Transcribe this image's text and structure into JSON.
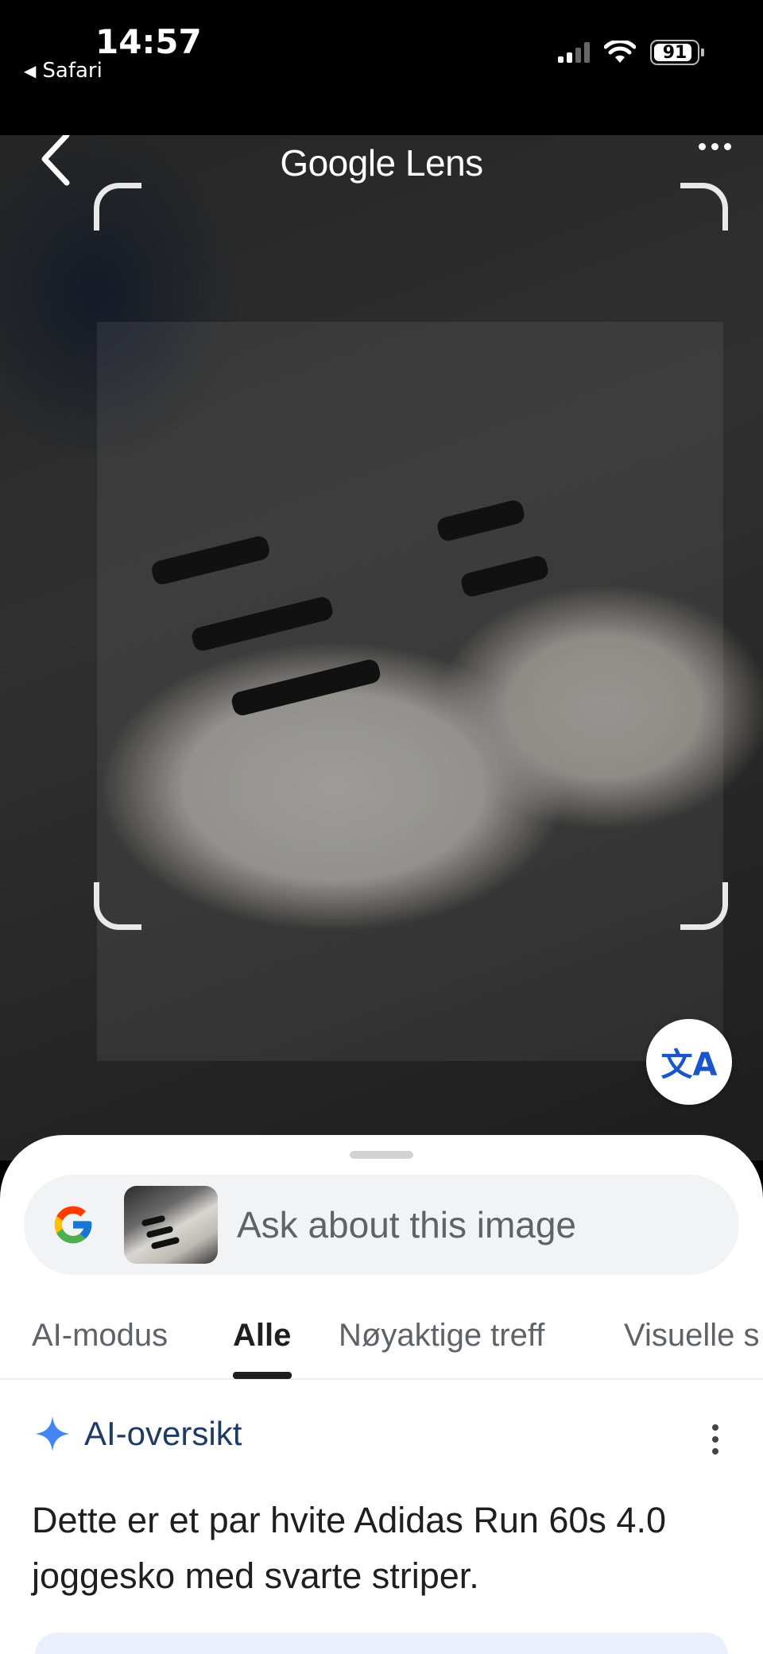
{
  "status_bar": {
    "time": "14:57",
    "back_app": "Safari",
    "battery": "91",
    "battery_level": 0.91
  },
  "header": {
    "title": "Google Lens",
    "back_icon": "chevron-left-icon",
    "more_icon": "more-horizontal-icon"
  },
  "translate_button": {
    "icon": "translate-icon",
    "glyph": "文A"
  },
  "search": {
    "placeholder": "Ask about this image"
  },
  "tabs": [
    {
      "label": "AI-modus"
    },
    {
      "label": "Alle",
      "active": true
    },
    {
      "label": "Nøyaktige treff"
    },
    {
      "label": "Visuelle s"
    }
  ],
  "ai_overview": {
    "heading": "AI-oversikt",
    "answer": "Dette er et par hvite Adidas Run 60s 4.0 joggesko med svarte striper."
  },
  "colors": {
    "accent_blue": "#1a56c8",
    "heading_navy": "#1f3a64",
    "sparkle_blue": "#4285f4"
  }
}
